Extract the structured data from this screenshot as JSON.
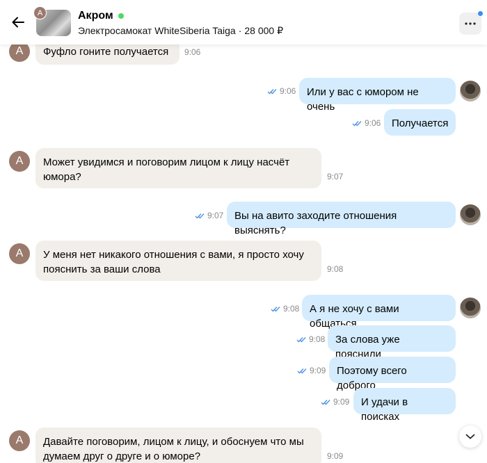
{
  "header": {
    "back_icon": "arrow-left-icon",
    "seller_initial": "А",
    "name": "Акром",
    "online_color": "#4cd964",
    "item_title": "Электросамокат WhiteSiberia Taiga",
    "separator": "·",
    "price": "28 000 ₽",
    "menu_icon": "more-dots-icon",
    "badge_color": "#3b8cf7"
  },
  "colors": {
    "incoming_bubble": "#f2efea",
    "outgoing_bubble": "#d4ecfd",
    "read_ticks": "#4a90e2"
  },
  "messages": [
    {
      "direction": "in",
      "text": "Фуфло гоните получается",
      "time": "9:06",
      "avatar": "А"
    },
    {
      "direction": "out",
      "text": "Или у вас с юмором не очень",
      "time": "9:06",
      "read": true
    },
    {
      "direction": "out",
      "text": "Получается",
      "time": "9:06",
      "read": true
    },
    {
      "direction": "in",
      "text_lines": [
        "Может увидимся и поговорим лицом к лицу насчёт",
        "юмора?"
      ],
      "time": "9:07",
      "avatar": "А"
    },
    {
      "direction": "out",
      "text": "Вы на авито заходите отношения выяснять?",
      "time": "9:07",
      "read": true
    },
    {
      "direction": "in",
      "text_lines": [
        "У меня нет никакого отношения с вами, я просто хочу",
        "пояснить за ваши слова"
      ],
      "time": "9:08",
      "avatar": "А"
    },
    {
      "direction": "out",
      "text": "А я не хочу с вами общаться",
      "time": "9:08",
      "read": true
    },
    {
      "direction": "out",
      "text": "За слова уже пояснили",
      "time": "9:08",
      "read": true
    },
    {
      "direction": "out",
      "text": "Поэтому всего доброго",
      "time": "9:09",
      "read": true
    },
    {
      "direction": "out",
      "text": "И удачи в поисках",
      "time": "9:09",
      "read": true
    },
    {
      "direction": "in",
      "text_lines": [
        "Давайте поговорим, лицом к лицу, и обоснуем что мы",
        "думаем друг о друге и о юморе?"
      ],
      "time": "9:09",
      "avatar": "А"
    }
  ],
  "scroll_icon": "chevron-down-icon"
}
